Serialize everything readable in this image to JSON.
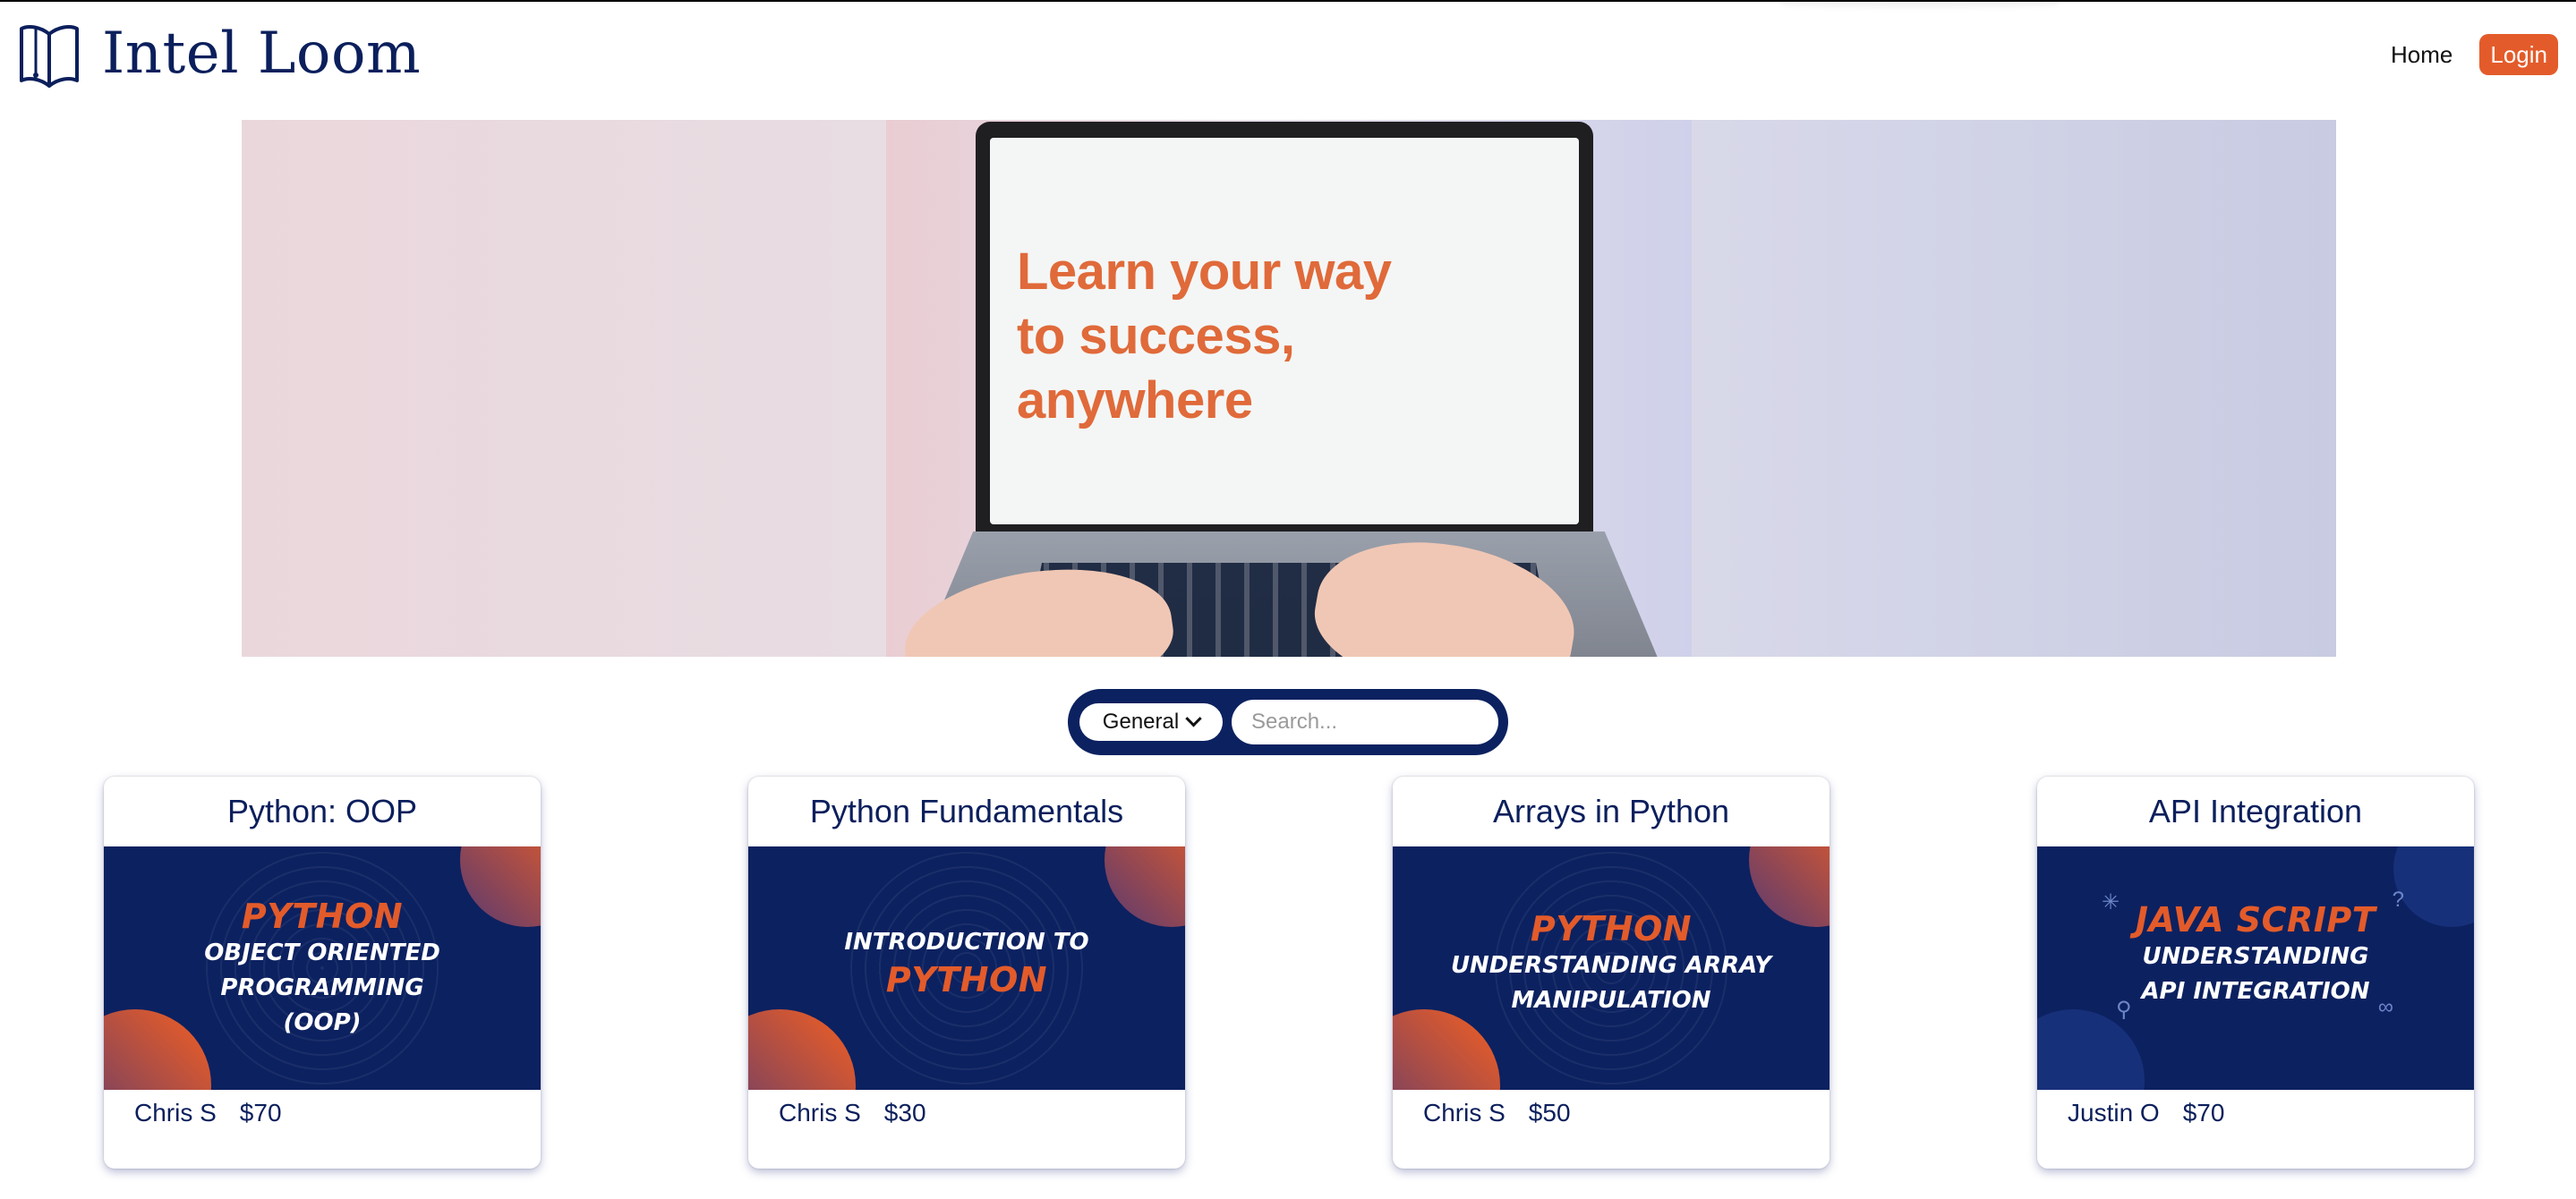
{
  "header": {
    "brand_name": "Intel Loom",
    "nav": {
      "home": "Home",
      "login": "Login"
    }
  },
  "hero": {
    "headline_lines": [
      "Learn your way",
      "to success,",
      "anywhere"
    ]
  },
  "search": {
    "category_selected": "General",
    "placeholder": "Search..."
  },
  "colors": {
    "accent": "#e35b2a",
    "navy": "#0c2160",
    "text": "#0b1f5c"
  },
  "courses": [
    {
      "title": "Python: OOP",
      "thumb_lines": [
        "PYTHON",
        "OBJECT ORIENTED",
        "PROGRAMMING",
        "(OOP)"
      ],
      "author": "Chris S",
      "price": "$70"
    },
    {
      "title": "Python Fundamentals",
      "thumb_lines": [
        "INTRODUCTION TO",
        "PYTHON"
      ],
      "author": "Chris S",
      "price": "$30"
    },
    {
      "title": "Arrays in Python",
      "thumb_lines": [
        "PYTHON",
        "UNDERSTANDING ARRAY",
        "MANIPULATION"
      ],
      "author": "Chris S",
      "price": "$50"
    },
    {
      "title": "API Integration",
      "thumb_lines": [
        "JAVA SCRIPT",
        "UNDERSTANDING",
        "API INTEGRATION"
      ],
      "author": "Justin O",
      "price": "$70"
    }
  ]
}
